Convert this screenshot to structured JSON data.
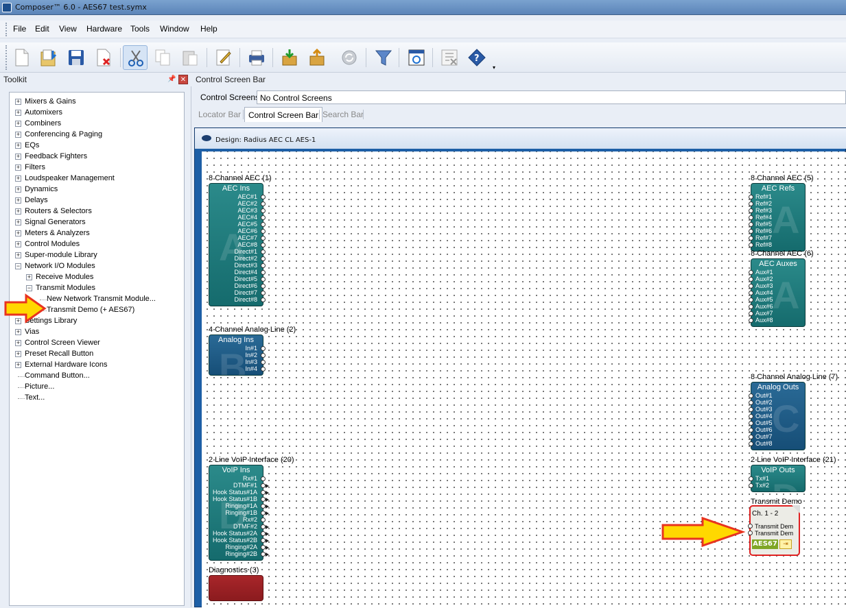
{
  "window": {
    "title": "Composer™ 6.0 - AES67 test.symx"
  },
  "menu": [
    "File",
    "Edit",
    "View",
    "Hardware",
    "Tools",
    "Window",
    "Help"
  ],
  "toolbar": {
    "buttons": [
      "new-icon",
      "open-icon",
      "save-icon",
      "close-file-icon",
      "cut-icon",
      "copy-icon",
      "paste-icon",
      "edit-icon",
      "print-icon",
      "download-icon",
      "upload-icon",
      "refresh-icon",
      "filter-icon",
      "screen-icon",
      "delete-icon",
      "help-icon"
    ]
  },
  "toolkit": {
    "title": "Toolkit",
    "items": [
      {
        "label": "Mixers & Gains",
        "level": 0,
        "exp": "+"
      },
      {
        "label": "Automixers",
        "level": 0,
        "exp": "+"
      },
      {
        "label": "Combiners",
        "level": 0,
        "exp": "+"
      },
      {
        "label": "Conferencing & Paging",
        "level": 0,
        "exp": "+"
      },
      {
        "label": "EQs",
        "level": 0,
        "exp": "+"
      },
      {
        "label": "Feedback Fighters",
        "level": 0,
        "exp": "+"
      },
      {
        "label": "Filters",
        "level": 0,
        "exp": "+"
      },
      {
        "label": "Loudspeaker Management",
        "level": 0,
        "exp": "+"
      },
      {
        "label": "Dynamics",
        "level": 0,
        "exp": "+"
      },
      {
        "label": "Delays",
        "level": 0,
        "exp": "+"
      },
      {
        "label": "Routers & Selectors",
        "level": 0,
        "exp": "+"
      },
      {
        "label": "Signal Generators",
        "level": 0,
        "exp": "+"
      },
      {
        "label": "Meters & Analyzers",
        "level": 0,
        "exp": "+"
      },
      {
        "label": "Control Modules",
        "level": 0,
        "exp": "+"
      },
      {
        "label": "Super-module Library",
        "level": 0,
        "exp": "+"
      },
      {
        "label": "Network I/O Modules",
        "level": 0,
        "exp": "-"
      },
      {
        "label": "Receive Modules",
        "level": 1,
        "exp": "+"
      },
      {
        "label": "Transmit Modules",
        "level": 1,
        "exp": "-"
      },
      {
        "label": "New Network Transmit Module...",
        "level": 2,
        "exp": ""
      },
      {
        "label": "Transmit Demo (+ AES67)",
        "level": 2,
        "exp": ""
      },
      {
        "label": "Settings Library",
        "level": 0,
        "exp": "+"
      },
      {
        "label": "Vias",
        "level": 0,
        "exp": "+"
      },
      {
        "label": "Control Screen Viewer",
        "level": 0,
        "exp": "+"
      },
      {
        "label": "Preset Recall Button",
        "level": 0,
        "exp": "+"
      },
      {
        "label": "External Hardware Icons",
        "level": 0,
        "exp": "+"
      },
      {
        "label": "Command Button...",
        "level": 0,
        "exp": ""
      },
      {
        "label": "Picture...",
        "level": 0,
        "exp": ""
      },
      {
        "label": "Text...",
        "level": 0,
        "exp": ""
      }
    ]
  },
  "control_bar": {
    "title": "Control Screen Bar",
    "label": "Control Screens:",
    "value": "No Control Screens",
    "tabs": [
      "Locator Bar",
      "Control Screen Bar",
      "Search Bar"
    ],
    "active_tab": "Control Screen Bar"
  },
  "design": {
    "title": "Design: Radius AEC CL AES-1",
    "blocks": [
      {
        "caption": "8 Channel AEC (1)",
        "title": "AEC Ins",
        "letter": "A",
        "color": "teal",
        "side": "right",
        "pins": [
          "AEC#1",
          "AEC#2",
          "AEC#3",
          "AEC#4",
          "AEC#5",
          "AEC#6",
          "AEC#7",
          "AEC#8",
          "Direct#1",
          "Direct#2",
          "Direct#3",
          "Direct#4",
          "Direct#5",
          "Direct#6",
          "Direct#7",
          "Direct#8"
        ]
      },
      {
        "caption": "4 Channel Analog Line (2)",
        "title": "Analog Ins",
        "letter": "B",
        "color": "blue",
        "side": "right",
        "pins": [
          "In#1",
          "In#2",
          "In#3",
          "In#4"
        ]
      },
      {
        "caption": "2 Line VoIP Interface (20)",
        "title": "VoIP Ins",
        "letter": "D",
        "color": "teal",
        "side": "right",
        "pins": [
          "Rx#1",
          "DTMF#1",
          "Hook Status#1A",
          "Hook Status#1B",
          "Ringing#1A",
          "Ringing#1B",
          "Rx#2",
          "DTMF#2",
          "Hook Status#2A",
          "Hook Status#2B",
          "Ringing#2A",
          "Ringing#2B"
        ]
      },
      {
        "caption": "8 Channel AEC (5)",
        "title": "AEC Refs",
        "letter": "A",
        "color": "teal",
        "side": "left",
        "pins": [
          "Ref#1",
          "Ref#2",
          "Ref#3",
          "Ref#4",
          "Ref#5",
          "Ref#6",
          "Ref#7",
          "Ref#8"
        ]
      },
      {
        "caption": "8 Channel AEC (6)",
        "title": "AEC Auxes",
        "letter": "A",
        "color": "teal",
        "side": "left",
        "pins": [
          "Aux#1",
          "Aux#2",
          "Aux#3",
          "Aux#4",
          "Aux#5",
          "Aux#6",
          "Aux#7",
          "Aux#8"
        ]
      },
      {
        "caption": "8 Channel Analog Line (7)",
        "title": "Analog Outs",
        "letter": "C",
        "color": "blue",
        "side": "left",
        "pins": [
          "Out#1",
          "Out#2",
          "Out#3",
          "Out#4",
          "Out#5",
          "Out#6",
          "Out#7",
          "Out#8"
        ]
      },
      {
        "caption": "2 Line VoIP Interface (21)",
        "title": "VoIP Outs",
        "letter": "D",
        "color": "teal",
        "side": "left",
        "pins": [
          "Tx#1",
          "Tx#2"
        ]
      }
    ],
    "diagnostics": {
      "caption": "Diagnostics (3)"
    },
    "transmit": {
      "caption": "Transmit Demo",
      "channel": "Ch. 1 - 2",
      "pins": [
        "Transmit Dem",
        "Transmit Dem"
      ],
      "badge": "AES67"
    }
  },
  "colors": {
    "teal": "#1f7b7c",
    "blue": "#1d5b87",
    "highlight": "#e02020",
    "arrow": "#ffd800"
  }
}
